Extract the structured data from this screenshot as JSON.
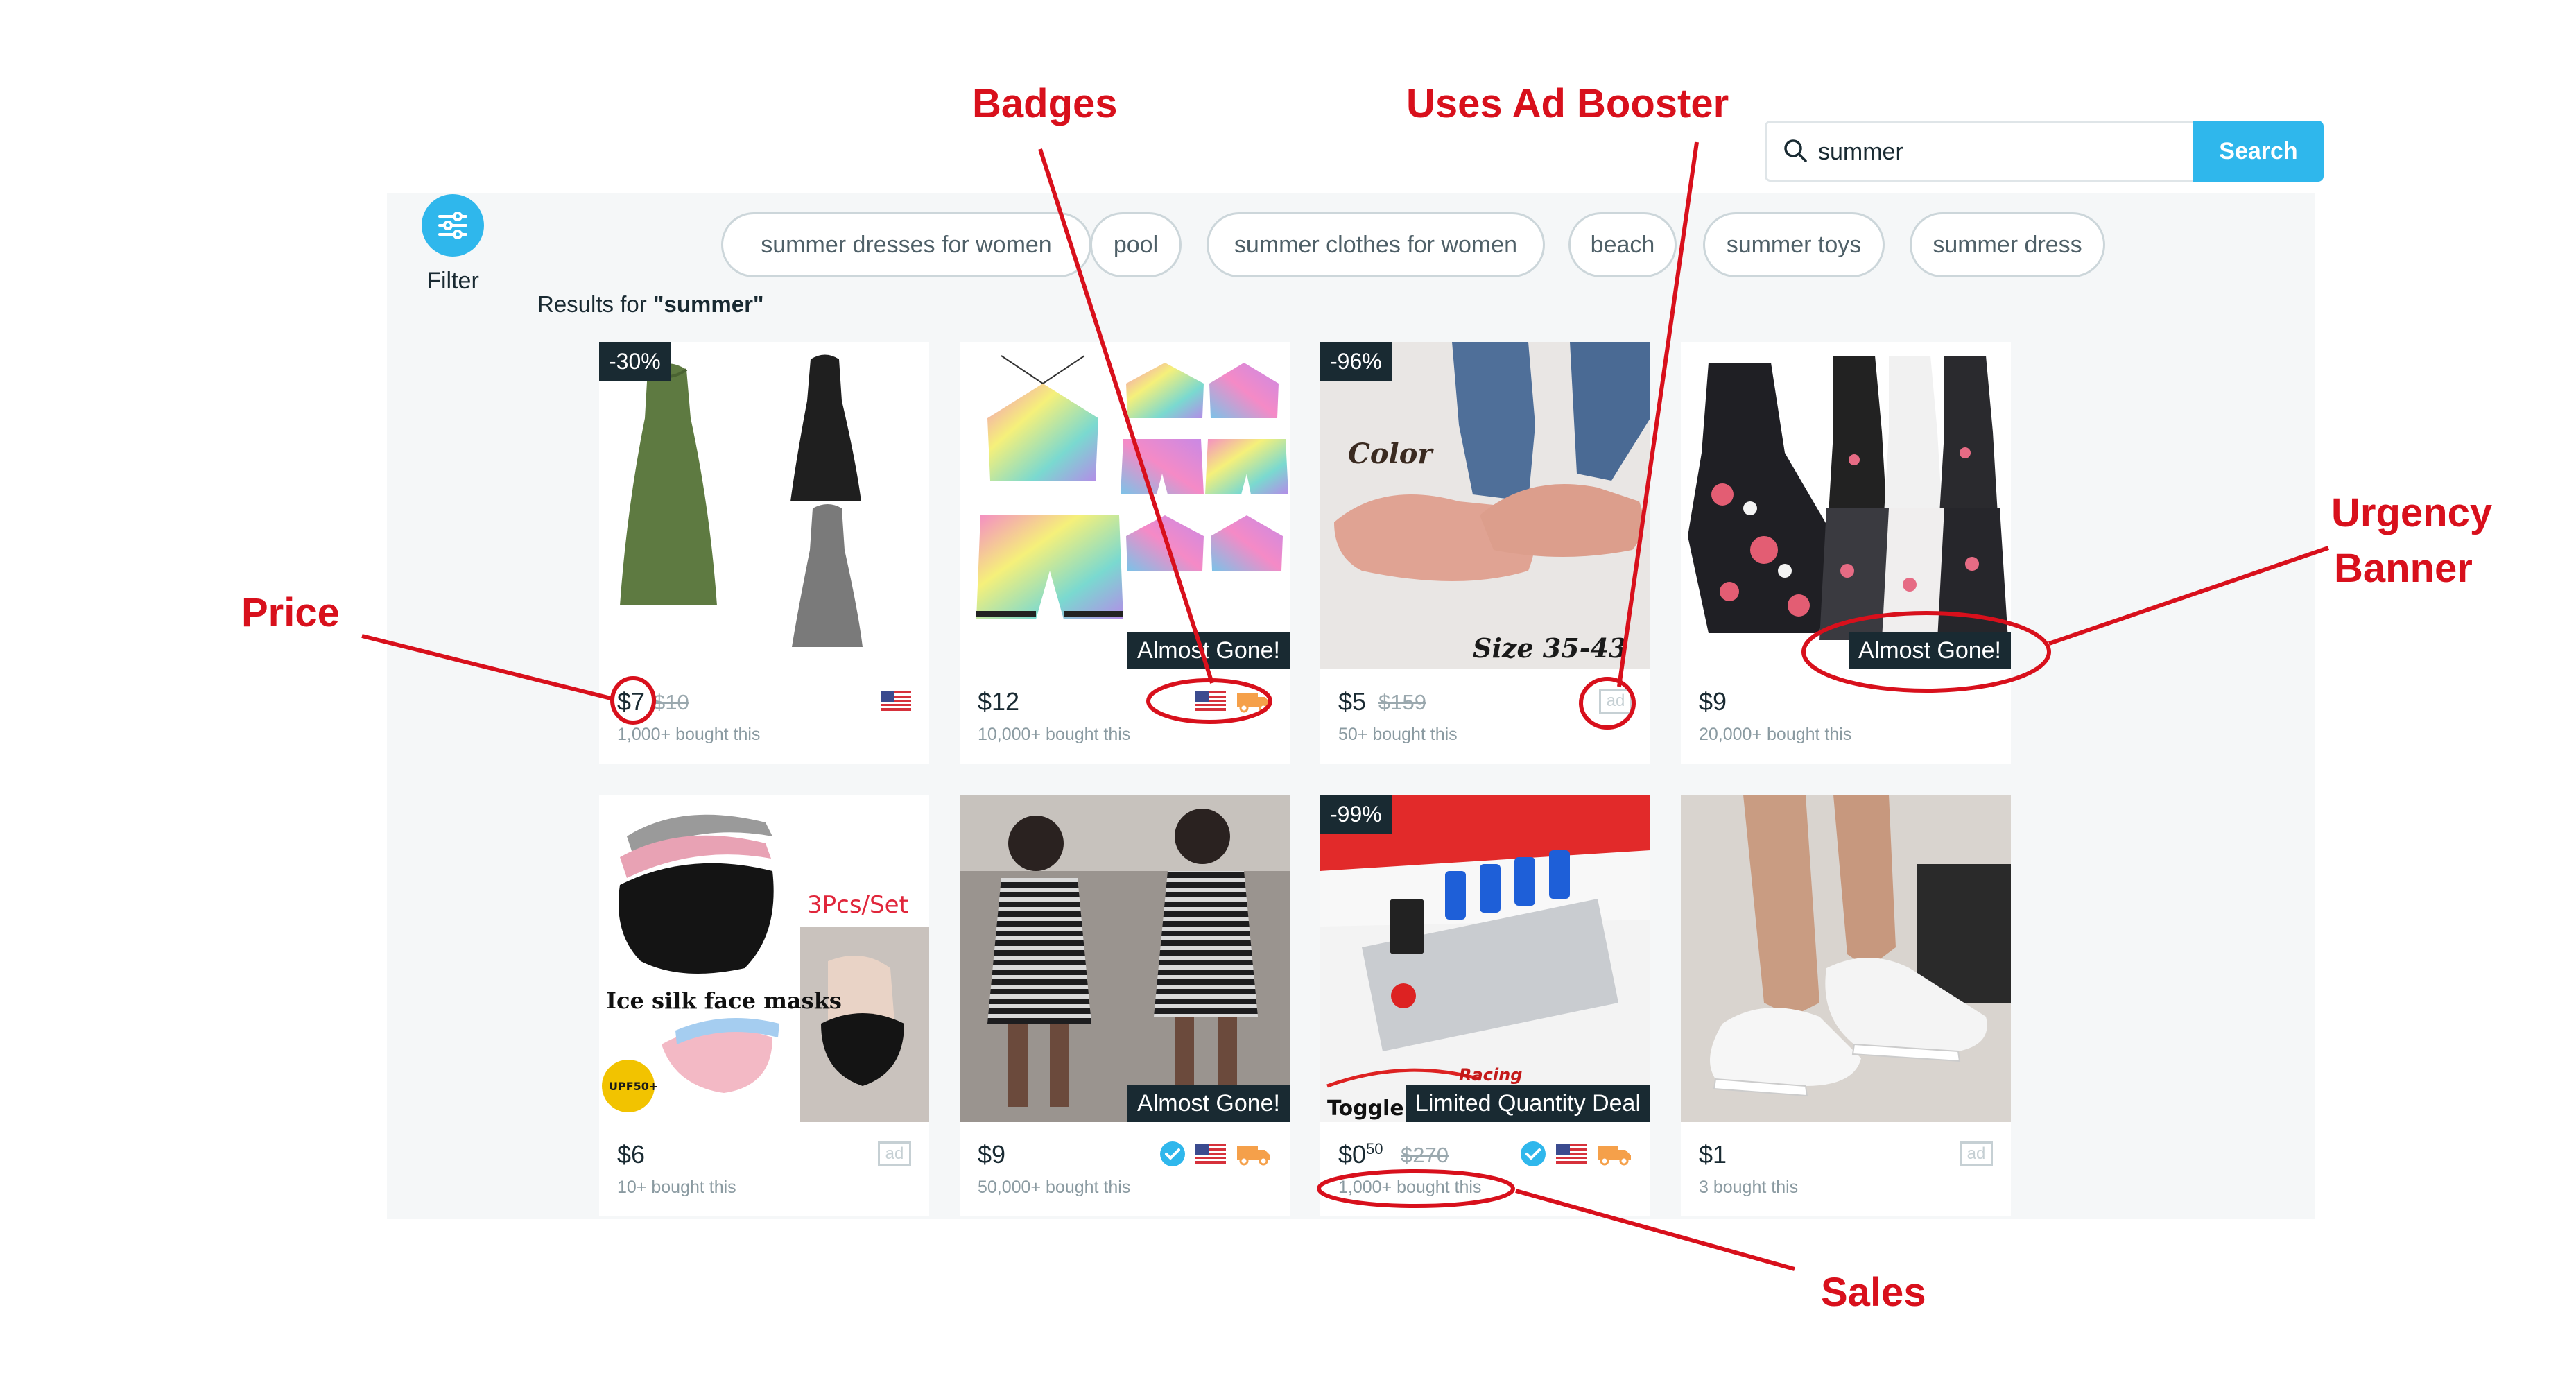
{
  "search": {
    "value": "summer",
    "button": "Search"
  },
  "filter": {
    "label": "Filter"
  },
  "chips": [
    "summer dresses for women",
    "pool",
    "summer clothes for women",
    "beach",
    "summer toys",
    "summer dress"
  ],
  "results": {
    "prefix": "Results for ",
    "query": "\"summer\""
  },
  "products": [
    {
      "discount": "-30%",
      "price": "$7",
      "old_price": "$10",
      "sold": "1,000+ bought this",
      "icons": [
        "us-flag"
      ]
    },
    {
      "banner": "Almost Gone!",
      "price": "$12",
      "sold": "10,000+ bought this",
      "icons": [
        "us-flag",
        "shipping-truck"
      ]
    },
    {
      "discount": "-96%",
      "price": "$5",
      "old_price": "$159",
      "sold": "50+ bought this",
      "icons": [
        "ad"
      ],
      "image_text": [
        "Color",
        "Size 35-43"
      ]
    },
    {
      "banner": "Almost Gone!",
      "price": "$9",
      "sold": "20,000+ bought this",
      "icons": []
    },
    {
      "price": "$6",
      "sold": "10+ bought this",
      "icons": [
        "ad"
      ],
      "image_text": [
        "3Pcs/Set",
        "Ice silk face masks",
        "UPF50+"
      ]
    },
    {
      "banner": "Almost Gone!",
      "price": "$9",
      "sold": "50,000+ bought this",
      "icons": [
        "verified",
        "us-flag",
        "shipping-truck"
      ]
    },
    {
      "discount": "-99%",
      "banner": "Limited Quantity Deal",
      "price": "$0",
      "price_cents": "50",
      "old_price": "$270",
      "sold": "1,000+ bought this",
      "icons": [
        "verified",
        "us-flag",
        "shipping-truck"
      ],
      "image_text": [
        "Toggle",
        "Racing"
      ]
    },
    {
      "price": "$1",
      "sold": "3 bought this",
      "icons": [
        "ad"
      ]
    }
  ],
  "ad_label": "ad",
  "annotations": {
    "badges": "Badges",
    "ad_booster": "Uses Ad Booster",
    "price": "Price",
    "urgency": "Urgency",
    "banner": "Banner",
    "sales": "Sales"
  },
  "colors": {
    "accent": "#2fb7ec",
    "annotation": "#d8101c",
    "dark_tag": "#192a32"
  }
}
